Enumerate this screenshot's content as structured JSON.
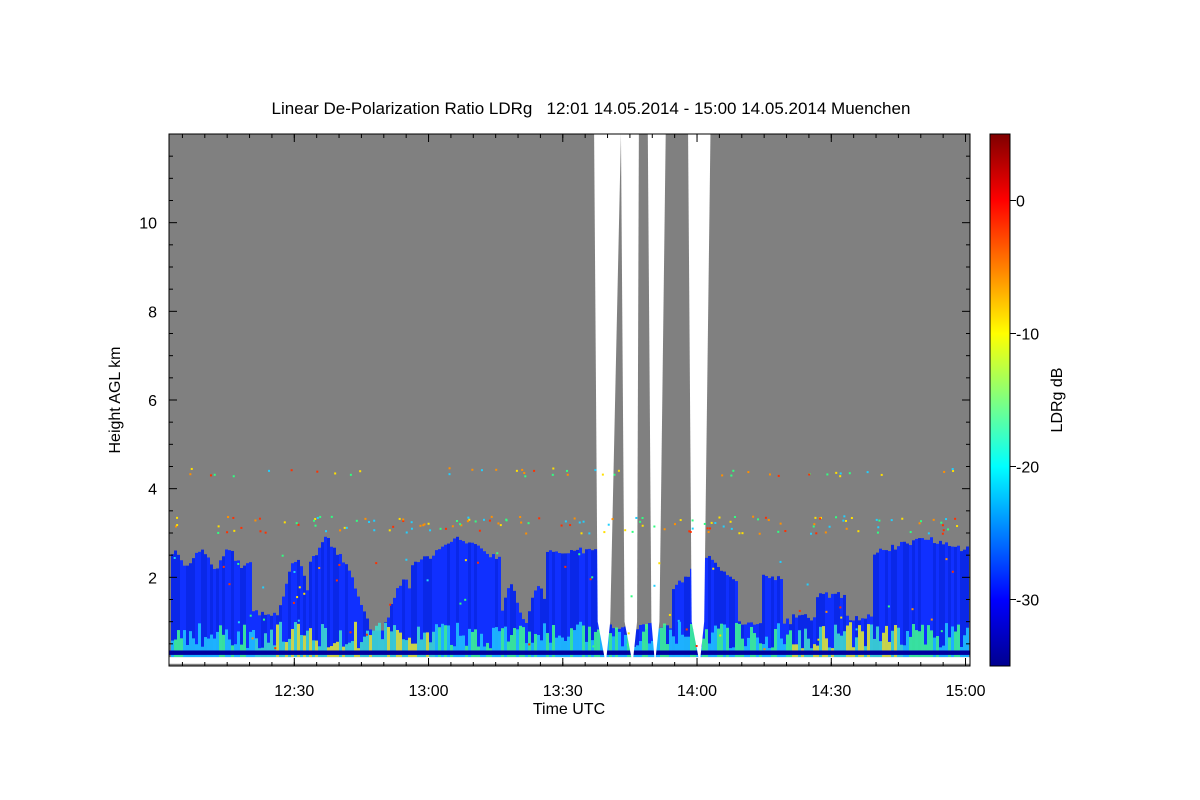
{
  "chart_data": {
    "type": "heatmap",
    "title": "Linear De-Polarization Ratio LDRg   12:01 14.05.2014 - 15:00 14.05.2014 Muenchen",
    "xlabel": "Time UTC",
    "ylabel": "Height AGL km",
    "xlim": [
      "12:01",
      "15:00"
    ],
    "ylim": [
      0,
      12
    ],
    "x_tick_labels": [
      "12:30",
      "13:00",
      "13:30",
      "14:00",
      "14:30",
      "15:00"
    ],
    "x_tick_minutes": [
      29,
      59,
      89,
      119,
      149,
      179
    ],
    "y_tick_labels": [
      "2",
      "4",
      "6",
      "8",
      "10"
    ],
    "y_tick_values": [
      2,
      4,
      6,
      8,
      10
    ],
    "colorbar": {
      "label": "LDRg dB",
      "range": [
        -35,
        5
      ],
      "tick_labels": [
        "0",
        "-10",
        "-20",
        "-30"
      ],
      "tick_values": [
        0,
        -10,
        -20,
        -30
      ],
      "colormap": "jet"
    },
    "background_color": "#808080",
    "no_data_color": "#ffffff"
  }
}
